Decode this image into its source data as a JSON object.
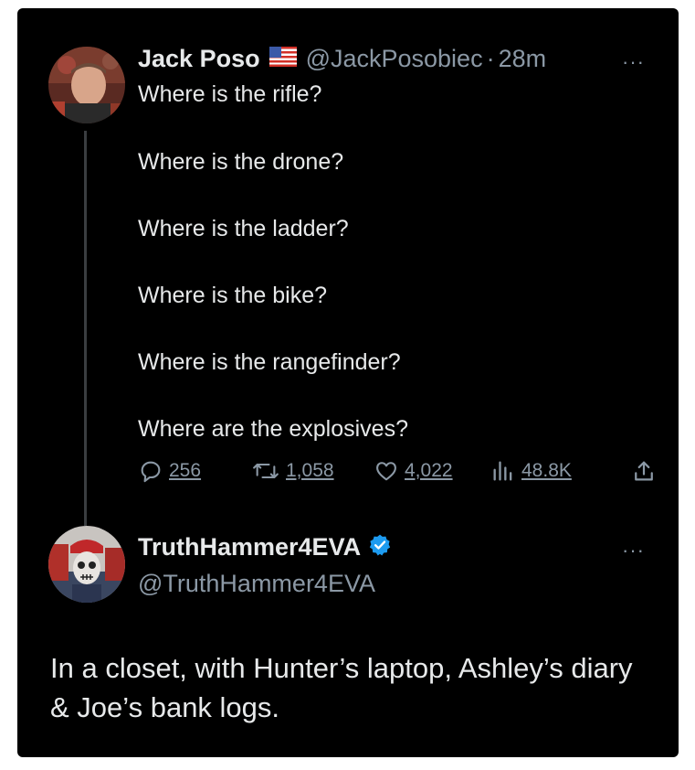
{
  "tweet": {
    "author_name": "Jack Poso",
    "author_flag": "us-flag-icon",
    "author_handle": "@JackPosobiec",
    "separator": "·",
    "time": "28m",
    "lines": [
      "Where is the rifle?",
      "Where is the drone?",
      "Where is the ladder?",
      "Where is the bike?",
      "Where is the rangefinder?",
      "Where are the explosives?"
    ],
    "more": "···",
    "stats": {
      "replies": "256",
      "reposts": "1,058",
      "likes": "4,022",
      "views": "48.8K"
    }
  },
  "reply": {
    "author_name": "TruthHammer4EVA",
    "author_handle": "@TruthHammer4EVA",
    "more": "···",
    "text": "In a closet, with Hunter’s laptop, Ashley’s diary & Joe’s bank logs."
  },
  "colors": {
    "background": "#000000",
    "primary_text": "#e7e9ea",
    "secondary_text": "#8b98a5",
    "verified": "#1d9bf0"
  }
}
